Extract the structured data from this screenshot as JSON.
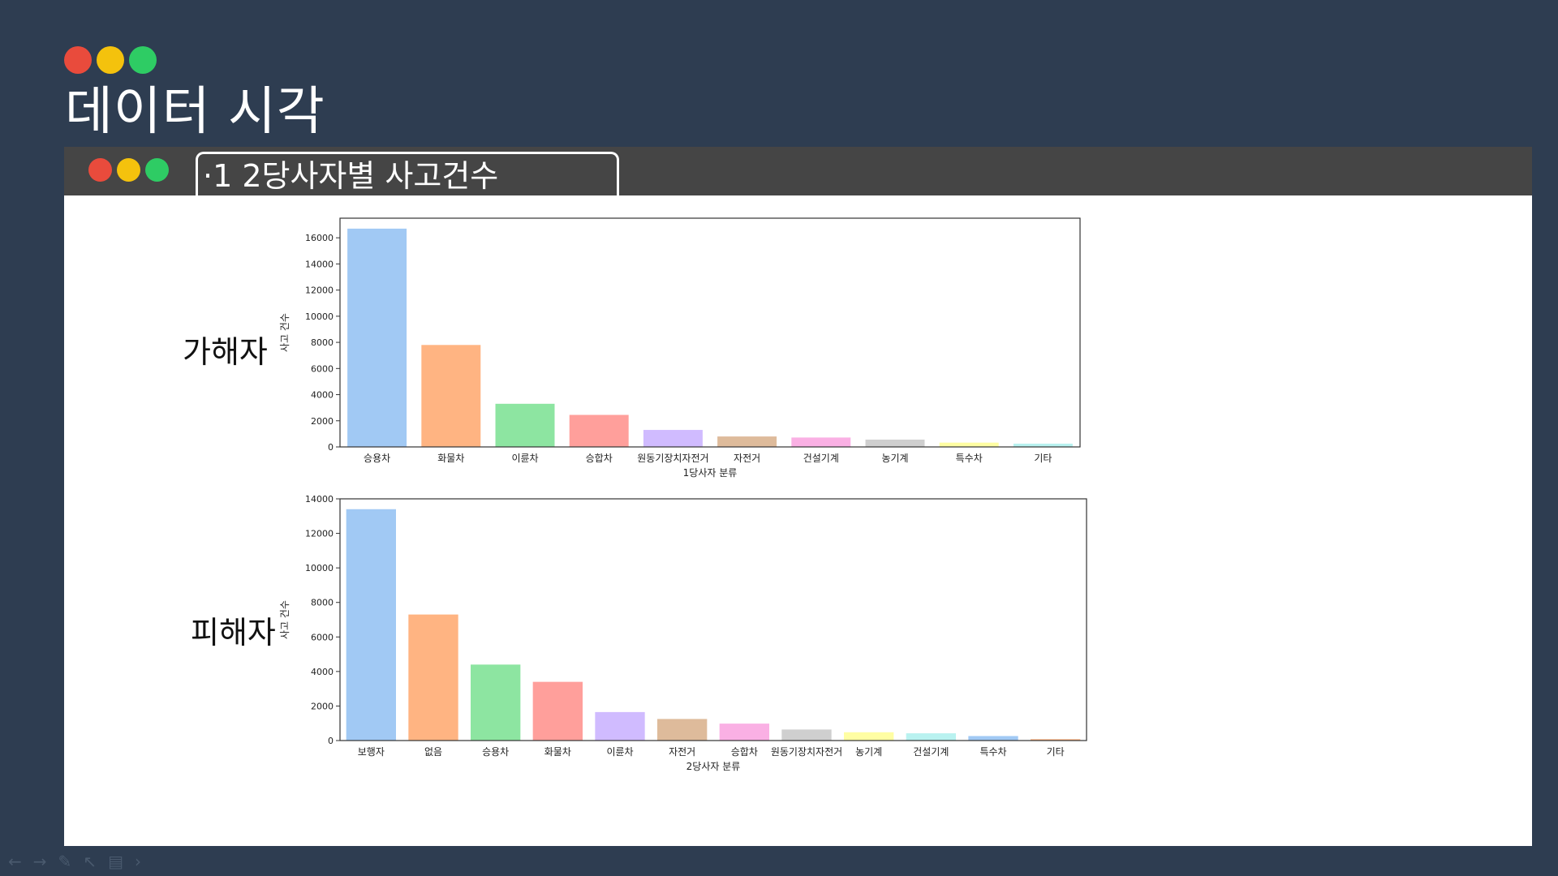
{
  "slide": {
    "title": "데이터 시각",
    "tab_label": "·1  2당사자별 사고건수",
    "colors": {
      "background": "#2e3d51",
      "header": "#454545",
      "dot_red": "#e94b3c",
      "dot_yellow": "#f4c20d",
      "dot_green": "#2ecc64"
    }
  },
  "labels": {
    "chart1": "가해자",
    "chart2": "피해자"
  },
  "toolbar": {
    "icons": [
      "arrow-left-icon",
      "arrow-right-icon",
      "pen-icon",
      "pointer-icon",
      "notes-icon",
      "chevron-right-icon"
    ]
  },
  "palette": [
    "#a1c9f4",
    "#ffb482",
    "#8de5a1",
    "#ff9f9b",
    "#d0bbff",
    "#debb9b",
    "#fab0e4",
    "#cfcfcf",
    "#fffea3",
    "#b9f2f0",
    "#a1c9f4",
    "#ffb482"
  ],
  "chart_data": [
    {
      "type": "bar",
      "categories": [
        "승용차",
        "화물차",
        "이륜차",
        "승합차",
        "원동기장치자전거",
        "자전거",
        "건설기계",
        "농기계",
        "특수차",
        "기타"
      ],
      "values": [
        16700,
        7800,
        3300,
        2450,
        1300,
        800,
        720,
        560,
        330,
        250
      ],
      "xlabel": "1당사자 분류",
      "ylabel": "사고 건수",
      "ylim": [
        0,
        17500
      ],
      "yticks": [
        0,
        2000,
        4000,
        6000,
        8000,
        10000,
        12000,
        14000,
        16000
      ],
      "grid": false
    },
    {
      "type": "bar",
      "categories": [
        "보행자",
        "없음",
        "승용차",
        "화물차",
        "이륜차",
        "자전거",
        "승합차",
        "원동기장치자전거",
        "농기계",
        "건설기계",
        "특수차",
        "기타"
      ],
      "values": [
        13400,
        7300,
        4400,
        3400,
        1650,
        1250,
        980,
        640,
        480,
        420,
        260,
        80
      ],
      "xlabel": "2당사자 분류",
      "ylabel": "사고 건수",
      "ylim": [
        0,
        14000
      ],
      "yticks": [
        0,
        2000,
        4000,
        6000,
        8000,
        10000,
        12000,
        14000
      ],
      "grid": false
    }
  ]
}
